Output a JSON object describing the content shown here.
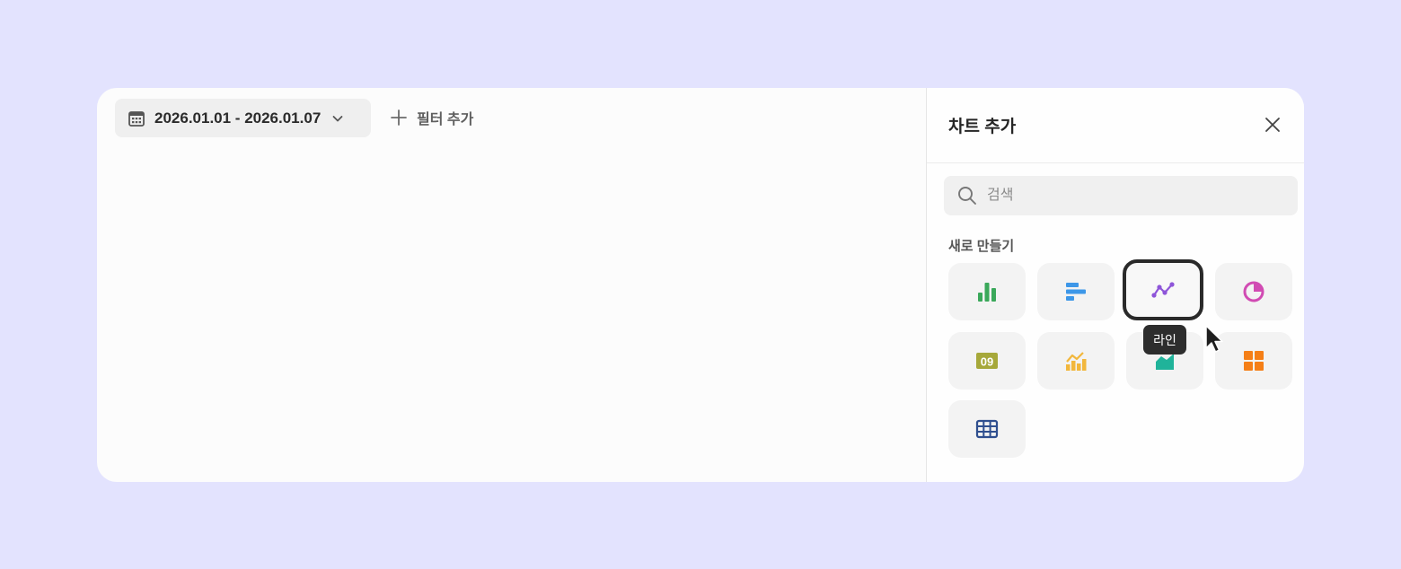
{
  "toolbar": {
    "date_range": "2026.01.01 - 2026.01.07",
    "add_filter_label": "필터 추가"
  },
  "panel": {
    "title": "차트 추가",
    "search": {
      "placeholder": "검색",
      "value": ""
    },
    "section_label": "새로 만들기",
    "tooltip": "라인",
    "chart_types": [
      {
        "icon": "bar-chart-icon",
        "color": "#3aa85a"
      },
      {
        "icon": "horizontal-bar-chart-icon",
        "color": "#3d97e8"
      },
      {
        "icon": "line-chart-icon",
        "color": "#8e55d9",
        "label": "라인",
        "selected": true
      },
      {
        "icon": "pie-chart-icon",
        "color": "#d14bb3"
      },
      {
        "icon": "number-card-icon",
        "color": "#a6a83a",
        "text": "09"
      },
      {
        "icon": "funnel-chart-icon",
        "color": "#f2b73c"
      },
      {
        "icon": "area-chart-icon",
        "color": "#20b39a"
      },
      {
        "icon": "grid-layout-icon",
        "color": "#f57f17"
      },
      {
        "icon": "table-icon",
        "color": "#2f4f8f"
      }
    ]
  }
}
